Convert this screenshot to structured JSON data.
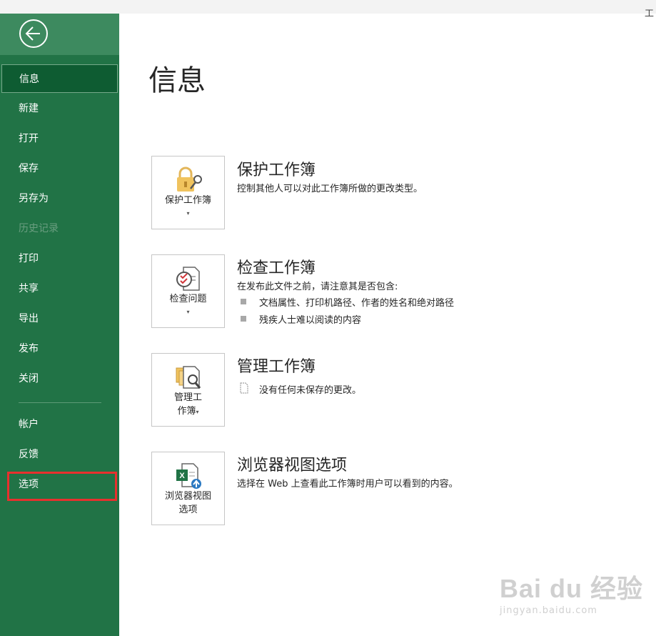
{
  "window": {
    "title": "工"
  },
  "sidebar": {
    "back_icon": "back-arrow-icon",
    "items": [
      {
        "label": "信息"
      },
      {
        "label": "新建"
      },
      {
        "label": "打开"
      },
      {
        "label": "保存"
      },
      {
        "label": "另存为"
      },
      {
        "label": "历史记录"
      },
      {
        "label": "打印"
      },
      {
        "label": "共享"
      },
      {
        "label": "导出"
      },
      {
        "label": "发布"
      },
      {
        "label": "关闭"
      },
      {
        "label": "帐户"
      },
      {
        "label": "反馈"
      },
      {
        "label": "选项"
      }
    ],
    "active_index": 0,
    "disabled_index": 5,
    "highlighted_index": 13,
    "colors": {
      "background": "#217346",
      "active": "#0e5c32",
      "highlight": "#e8302e"
    }
  },
  "main": {
    "title": "信息",
    "sections": [
      {
        "tile_line1": "保护工作簿",
        "tile_caret": "▾",
        "icon": "lock-key-icon",
        "title": "保护工作簿",
        "desc": "控制其他人可以对此工作簿所做的更改类型。"
      },
      {
        "tile_line1": "检查问题",
        "tile_caret": "▾",
        "icon": "inspect-document-icon",
        "title": "检查工作簿",
        "desc": "在发布此文件之前，请注意其是否包含:",
        "bullets": [
          "文档属性、打印机路径、作者的姓名和绝对路径",
          "残疾人士难以阅读的内容"
        ]
      },
      {
        "tile_line1": "管理工",
        "tile_line2": "作簿",
        "tile_caret": "▾",
        "icon": "manage-workbook-icon",
        "title": "管理工作簿",
        "note_icon": "document-icon",
        "desc": "没有任何未保存的更改。"
      },
      {
        "tile_line1": "浏览器视图",
        "tile_line2": "选项",
        "icon": "excel-web-icon",
        "title": "浏览器视图选项",
        "desc": "选择在 Web 上查看此工作簿时用户可以看到的内容。"
      }
    ]
  },
  "watermark": {
    "brand": "Bai du 经验",
    "url": "jingyan.baidu.com"
  }
}
